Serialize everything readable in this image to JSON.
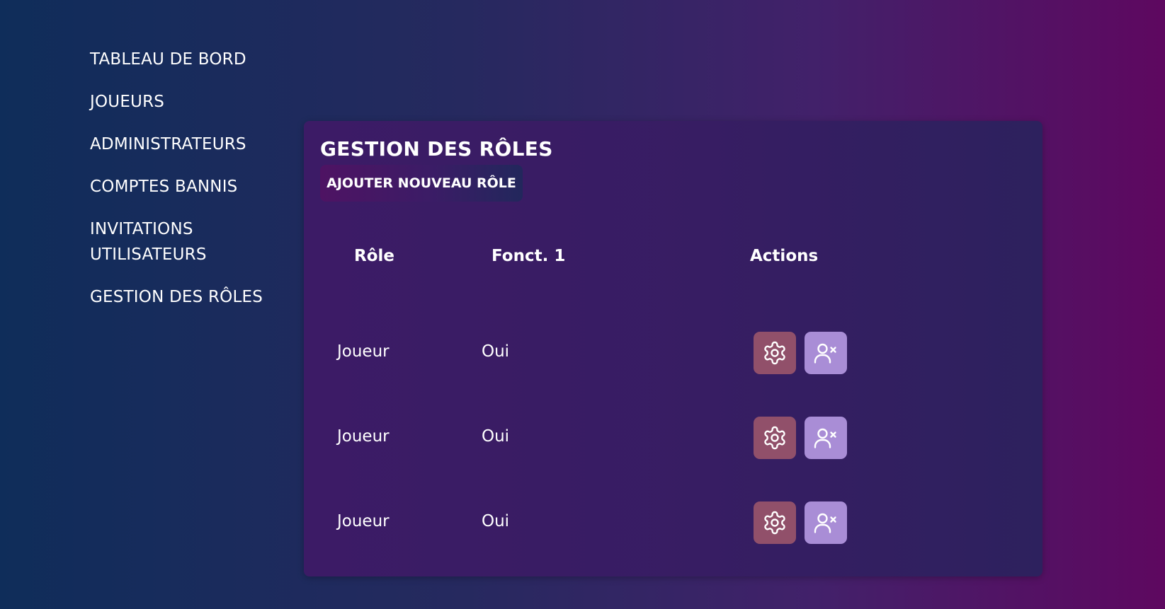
{
  "sidebar": {
    "items": [
      {
        "label": "TABLEAU DE BORD"
      },
      {
        "label": "JOUEURS"
      },
      {
        "label": "ADMINISTRATEURS"
      },
      {
        "label": "COMPTES BANNIS"
      },
      {
        "label": "INVITATIONS UTILISATEURS"
      },
      {
        "label": "GESTION DES RÔLES"
      }
    ]
  },
  "panel": {
    "title": "GESTION DES RÔLES",
    "add_button_label": "AJOUTER NOUVEAU RÔLE"
  },
  "table": {
    "headers": {
      "role": "Rôle",
      "func1": "Fonct. 1",
      "actions": "Actions"
    },
    "rows": [
      {
        "role": "Joueur",
        "func1": "Oui"
      },
      {
        "role": "Joueur",
        "func1": "Oui"
      },
      {
        "role": "Joueur",
        "func1": "Oui"
      }
    ]
  },
  "icons": {
    "settings": "gear-icon",
    "remove_user": "user-remove-icon"
  },
  "colors": {
    "settings_button": "#91506a",
    "remove_button": "#a98dd6"
  }
}
